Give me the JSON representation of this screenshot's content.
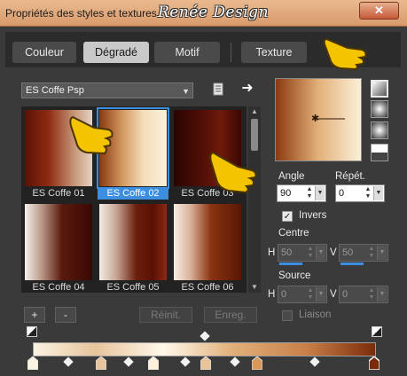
{
  "window": {
    "title": "Propriétés des styles et textures",
    "brand": "Renée Design",
    "close_label": "✕"
  },
  "tabs": [
    {
      "label": "Couleur",
      "active": false
    },
    {
      "label": "Dégradé",
      "active": true
    },
    {
      "label": "Motif",
      "active": false
    },
    {
      "label": "Texture",
      "active": false
    }
  ],
  "preset": {
    "selected": "ES Coffe Psp",
    "doc_icon": "document-icon",
    "next_icon": "arrow-right-icon"
  },
  "gradients": [
    {
      "label": "ES Coffe 01",
      "selected": false
    },
    {
      "label": "ES Coffe 02",
      "selected": true
    },
    {
      "label": "ES Coffe 03",
      "selected": false
    },
    {
      "label": "ES Coffe 04",
      "selected": false
    },
    {
      "label": "ES Coffe 05",
      "selected": false
    },
    {
      "label": "ES Coffe 06",
      "selected": false
    }
  ],
  "settings": {
    "angle_label": "Angle",
    "angle_value": "90",
    "repeat_label": "Répét.",
    "repeat_value": "0",
    "invert_label": "Invers",
    "invert_checked": true,
    "center_label": "Centre",
    "center_h_label": "H",
    "center_h": "50",
    "center_v_label": "V",
    "center_v": "50",
    "source_label": "Source",
    "source_h_label": "H",
    "source_h": "0",
    "source_v_label": "V",
    "source_v": "0",
    "link_label": "Liaison",
    "link_checked": false
  },
  "buttons": {
    "add": "+",
    "remove": "-",
    "reset": "Réinit.",
    "save": "Enreg."
  },
  "colors": {
    "accent": "#3b8ee0",
    "pointer": "#f4c400"
  }
}
